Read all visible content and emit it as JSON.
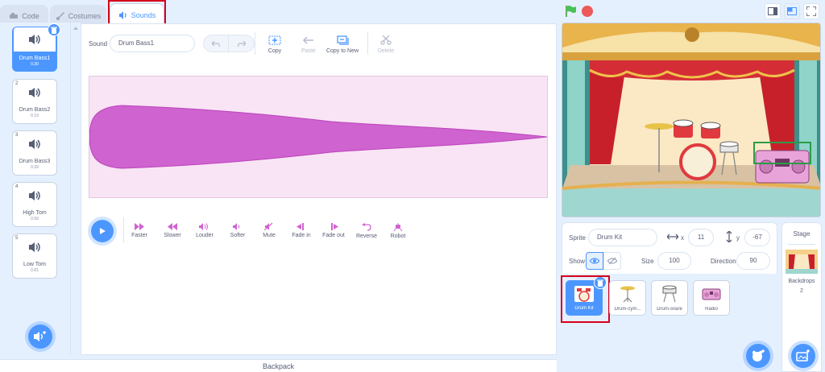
{
  "tabs": {
    "code": "Code",
    "costumes": "Costumes",
    "sounds": "Sounds"
  },
  "sounds": [
    {
      "num": "1",
      "name": "Drum Bass1",
      "duration": "0.30"
    },
    {
      "num": "2",
      "name": "Drum Bass2",
      "duration": "0.19"
    },
    {
      "num": "3",
      "name": "Drum Bass3",
      "duration": "0.39"
    },
    {
      "num": "4",
      "name": "High Tom",
      "duration": "0.56"
    },
    {
      "num": "5",
      "name": "Low Tom",
      "duration": "0.81"
    }
  ],
  "editor": {
    "sound_label": "Sound",
    "sound_name": "Drum Bass1",
    "tools": {
      "copy": "Copy",
      "paste": "Paste",
      "copy_to_new": "Copy to New",
      "delete": "Delete"
    },
    "effects": {
      "faster": "Faster",
      "slower": "Slower",
      "louder": "Louder",
      "softer": "Softer",
      "mute": "Mute",
      "fade_in": "Fade in",
      "fade_out": "Fade out",
      "reverse": "Reverse",
      "robot": "Robot"
    }
  },
  "backpack": "Backpack",
  "sprite_info": {
    "sprite_label": "Sprite",
    "sprite_name": "Drum Kit",
    "x_label": "x",
    "x": "11",
    "y_label": "y",
    "y": "-67",
    "show_label": "Show",
    "size_label": "Size",
    "size": "100",
    "direction_label": "Direction",
    "direction": "90"
  },
  "sprites": [
    {
      "name": "Drum Kit"
    },
    {
      "name": "Drum-cym..."
    },
    {
      "name": "Drum-snare"
    },
    {
      "name": "Radio"
    }
  ],
  "stage_col": {
    "title": "Stage",
    "backdrops_label": "Backdrops",
    "backdrops_count": "2"
  },
  "colors": {
    "accent": "#4c97ff",
    "wave": "#cf63cf",
    "highlight": "#d6001c",
    "flag": "#4cbf56",
    "stop": "#ec5959"
  }
}
